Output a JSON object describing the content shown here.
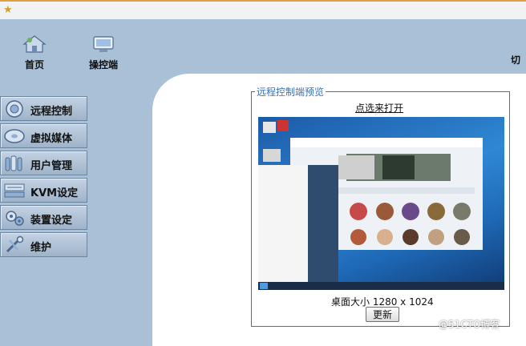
{
  "nav": {
    "home_label": "首页",
    "operator_label": "操控端",
    "right_label": "切"
  },
  "sidebar": {
    "items": [
      {
        "label": "远程控制",
        "icon": "remote-control-icon"
      },
      {
        "label": "虚拟媒体",
        "icon": "virtual-media-icon"
      },
      {
        "label": "用户管理",
        "icon": "user-management-icon"
      },
      {
        "label": "KVM设定",
        "icon": "kvm-settings-icon"
      },
      {
        "label": "装置设定",
        "icon": "device-settings-icon"
      },
      {
        "label": "维护",
        "icon": "maintenance-icon"
      }
    ]
  },
  "preview": {
    "legend": "远程控制端预览",
    "open_link": "点选来打开",
    "desktop_size": "桌面大小 1280 x 1024",
    "refresh_label": "更新"
  },
  "watermark": "@51CTO博客",
  "colors": {
    "background": "#a9c0d6",
    "legend_text": "#3a70b8"
  }
}
